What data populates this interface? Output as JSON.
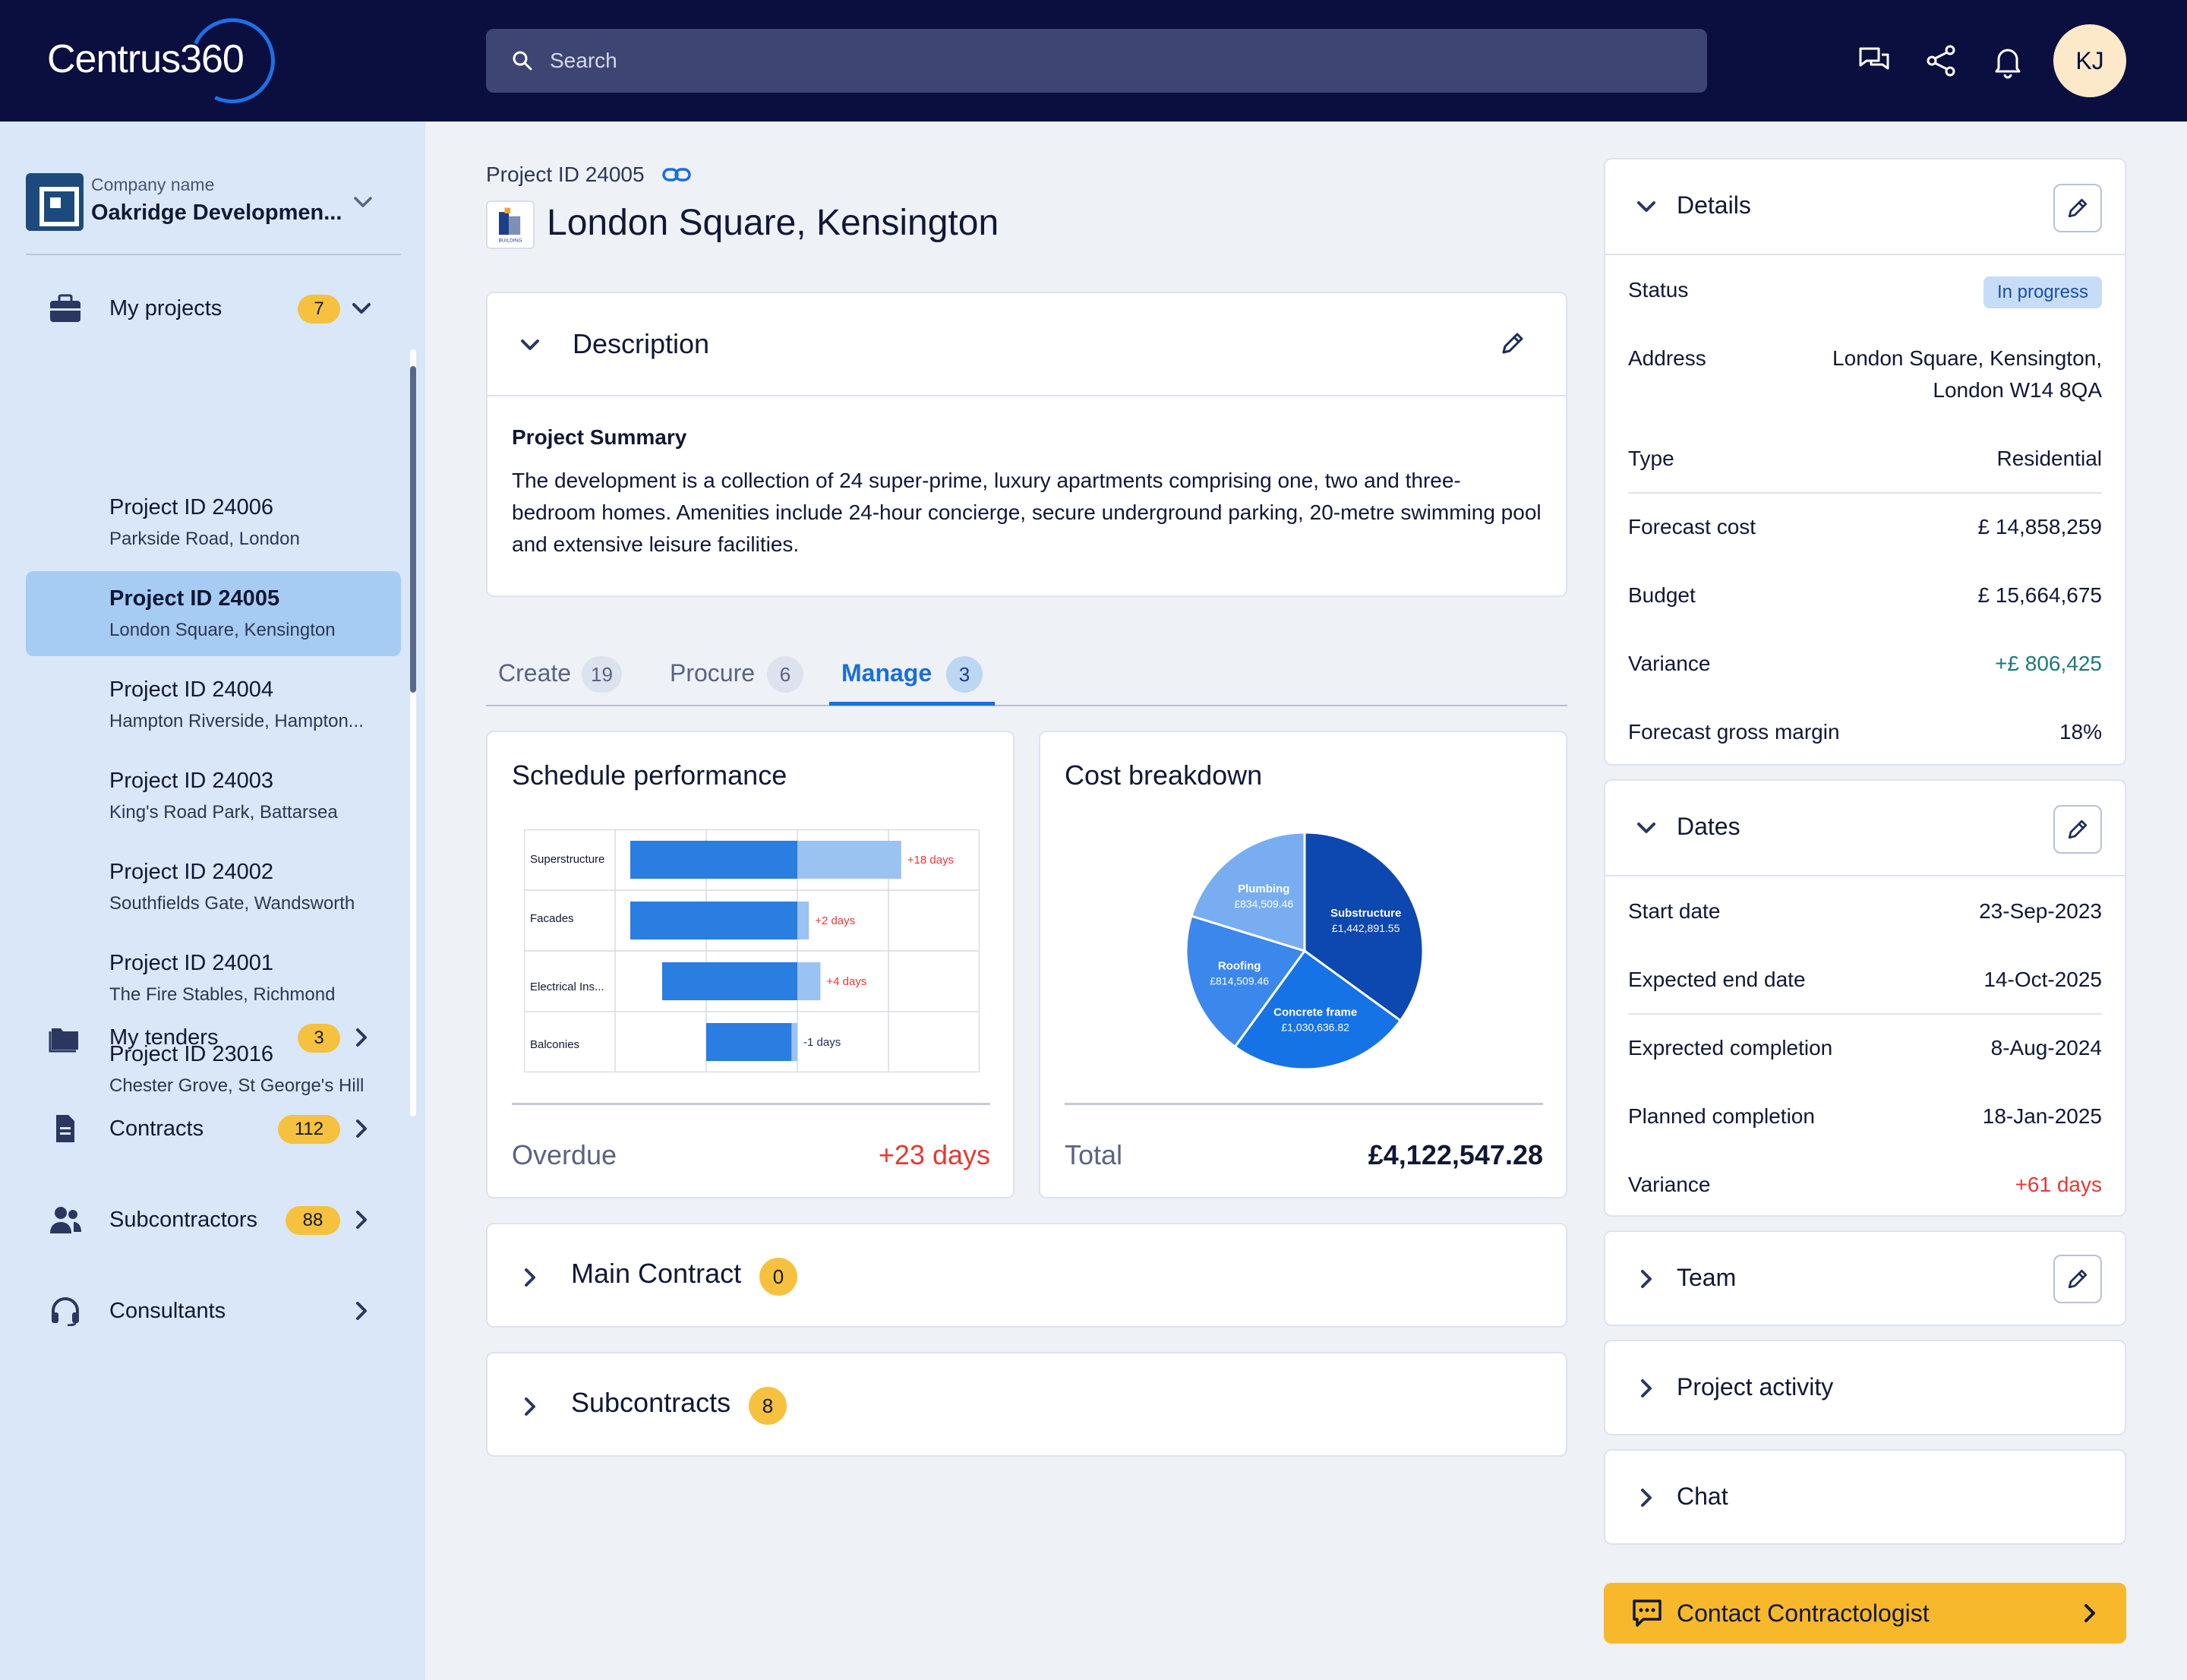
{
  "header": {
    "logo_text": "Centrus360",
    "search_placeholder": "Search",
    "avatar_initials": "KJ"
  },
  "sidebar": {
    "company_label": "Company name",
    "company_name": "Oakridge Developmen...",
    "my_projects": {
      "label": "My projects",
      "count": "7"
    },
    "projects": [
      {
        "id": "Project ID 24006",
        "location": "Parkside Road, London"
      },
      {
        "id": "Project ID 24005",
        "location": "London Square, Kensington"
      },
      {
        "id": "Project ID 24004",
        "location": "Hampton Riverside, Hampton..."
      },
      {
        "id": "Project ID 24003",
        "location": "King's Road Park, Battarsea"
      },
      {
        "id": "Project ID 24002",
        "location": "Southfields Gate, Wandsworth"
      },
      {
        "id": "Project ID 24001",
        "location": "The Fire Stables, Richmond"
      },
      {
        "id": "Project ID 23016",
        "location": "Chester Grove, St George's Hill"
      }
    ],
    "nav": [
      {
        "label": "My tenders",
        "count": "3"
      },
      {
        "label": "Contracts",
        "count": "112"
      },
      {
        "label": "Subcontractors",
        "count": "88"
      },
      {
        "label": "Consultants",
        "count": ""
      }
    ]
  },
  "main": {
    "breadcrumb": "Project ID 24005",
    "logo_caption": "BUILDING",
    "title": "London Square, Kensington",
    "description": {
      "heading": "Description",
      "summary_title": "Project Summary",
      "summary_text": "The development is a collection of 24 super-prime, luxury apartments comprising one, two and three-bedroom homes. Amenities include 24-hour concierge, secure underground parking, 20-metre swimming pool and extensive leisure facilities."
    },
    "tabs": [
      {
        "label": "Create",
        "count": "19"
      },
      {
        "label": "Procure",
        "count": "6"
      },
      {
        "label": "Manage",
        "count": "3"
      }
    ],
    "schedule": {
      "title": "Schedule performance",
      "footer_label": "Overdue",
      "footer_value": "+23 days"
    },
    "cost": {
      "title": "Cost breakdown",
      "footer_label": "Total",
      "footer_value": "£4,122,547.28"
    },
    "main_contract": {
      "label": "Main Contract",
      "count": "0"
    },
    "subcontracts": {
      "label": "Subcontracts",
      "count": "8"
    }
  },
  "chart_data": [
    {
      "type": "bar",
      "title": "Schedule performance",
      "categories": [
        "Superstructure",
        "Facades",
        "Electrical Ins...",
        "Balconies"
      ],
      "series": [
        {
          "values": [
            18,
            2,
            4,
            -1
          ]
        }
      ],
      "data_labels": [
        "+18 days",
        "+2 days",
        "+4 days",
        "-1 days"
      ],
      "grid": true
    },
    {
      "type": "pie",
      "title": "Cost breakdown",
      "categories": [
        "Substructure",
        "Concrete frame",
        "Roofing",
        "Plumbing"
      ],
      "values": [
        1442891.55,
        1030636.82,
        814509.46,
        834509.46
      ],
      "value_labels": [
        "£1,442,891.55",
        "£1,030,636.82",
        "£814,509.46",
        "£834,509.46"
      ],
      "colors": [
        "#0d47b0",
        "#1673e6",
        "#3b87ec",
        "#78adf2"
      ]
    }
  ],
  "details": {
    "heading": "Details",
    "status_label": "Status",
    "status_value": "In progress",
    "address_label": "Address",
    "address_line1": "London Square, Kensington,",
    "address_line2": "London W14 8QA",
    "type_label": "Type",
    "type_value": "Residential",
    "forecast_cost_label": "Forecast cost",
    "forecast_cost_value": "£ 14,858,259",
    "budget_label": "Budget",
    "budget_value": "£ 15,664,675",
    "variance_label": "Variance",
    "variance_value": "+£ 806,425",
    "margin_label": "Forecast gross margin",
    "margin_value": "18%"
  },
  "dates": {
    "heading": "Dates",
    "start_label": "Start date",
    "start_value": "23-Sep-2023",
    "expected_end_label": "Expected end date",
    "expected_end_value": "14-Oct-2025",
    "expected_completion_label": "Exprected completion",
    "expected_completion_value": "8-Aug-2024",
    "planned_completion_label": "Planned completion",
    "planned_completion_value": "18-Jan-2025",
    "variance_label": "Variance",
    "variance_value": "+61 days"
  },
  "collapsed_panels": {
    "team": "Team",
    "activity": "Project activity",
    "chat": "Chat"
  },
  "cta_label": "Contact Contractologist",
  "colors": {
    "navy": "#0b0f3f",
    "accent_blue": "#1a6ed8",
    "badge_yellow": "#f6c13e",
    "cta_yellow": "#f7b82c",
    "negative_red": "#e53935",
    "positive_teal": "#1a7a7a"
  }
}
